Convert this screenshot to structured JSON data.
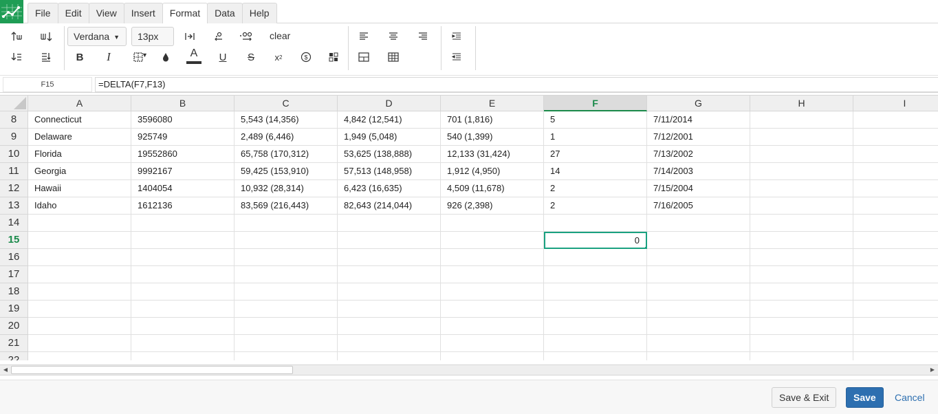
{
  "menu": {
    "items": [
      "File",
      "Edit",
      "View",
      "Insert",
      "Format",
      "Data",
      "Help"
    ],
    "active": "Format"
  },
  "toolbar": {
    "font_family": "Verdana",
    "font_size": "13px",
    "clear_label": "clear",
    "accent_color": "#1aa180",
    "text_color_bar": "#333333"
  },
  "formula_bar": {
    "cell_ref": "F15",
    "formula": "=DELTA(F7,F13)"
  },
  "grid": {
    "columns": [
      "A",
      "B",
      "C",
      "D",
      "E",
      "F",
      "G",
      "H",
      "I"
    ],
    "selected_column": "F",
    "selected_row": "15",
    "row_numbers": [
      "8",
      "9",
      "10",
      "11",
      "12",
      "13",
      "14",
      "15",
      "16",
      "17",
      "18",
      "19",
      "20",
      "21",
      "22"
    ],
    "rows": [
      [
        "Connecticut",
        "3596080",
        "5,543 (14,356)",
        "4,842 (12,541)",
        "701 (1,816)",
        "5",
        "7/11/2014",
        "",
        ""
      ],
      [
        "Delaware",
        "925749",
        "2,489 (6,446)",
        "1,949 (5,048)",
        "540 (1,399)",
        "1",
        "7/12/2001",
        "",
        ""
      ],
      [
        "Florida",
        "19552860",
        "65,758 (170,312)",
        "53,625 (138,888)",
        "12,133 (31,424)",
        "27",
        "7/13/2002",
        "",
        ""
      ],
      [
        "Georgia",
        "9992167",
        "59,425 (153,910)",
        "57,513 (148,958)",
        "1,912 (4,950)",
        "14",
        "7/14/2003",
        "",
        ""
      ],
      [
        "Hawaii",
        "1404054",
        "10,932 (28,314)",
        "6,423 (16,635)",
        "4,509 (11,678)",
        "2",
        "7/15/2004",
        "",
        ""
      ],
      [
        "Idaho",
        "1612136",
        "83,569 (216,443)",
        "82,643 (214,044)",
        "926 (2,398)",
        "2",
        "7/16/2005",
        "",
        ""
      ],
      [
        "",
        "",
        "",
        "",
        "",
        "",
        "",
        "",
        ""
      ],
      [
        "",
        "",
        "",
        "",
        "",
        "0",
        "",
        "",
        ""
      ],
      [
        "",
        "",
        "",
        "",
        "",
        "",
        "",
        "",
        ""
      ],
      [
        "",
        "",
        "",
        "",
        "",
        "",
        "",
        "",
        ""
      ],
      [
        "",
        "",
        "",
        "",
        "",
        "",
        "",
        "",
        ""
      ],
      [
        "",
        "",
        "",
        "",
        "",
        "",
        "",
        "",
        ""
      ],
      [
        "",
        "",
        "",
        "",
        "",
        "",
        "",
        "",
        ""
      ],
      [
        "",
        "",
        "",
        "",
        "",
        "",
        "",
        "",
        ""
      ],
      [
        "",
        "",
        "",
        "",
        "",
        "",
        "",
        "",
        ""
      ]
    ]
  },
  "footer": {
    "save_exit_label": "Save & Exit",
    "save_label": "Save",
    "cancel_label": "Cancel"
  }
}
